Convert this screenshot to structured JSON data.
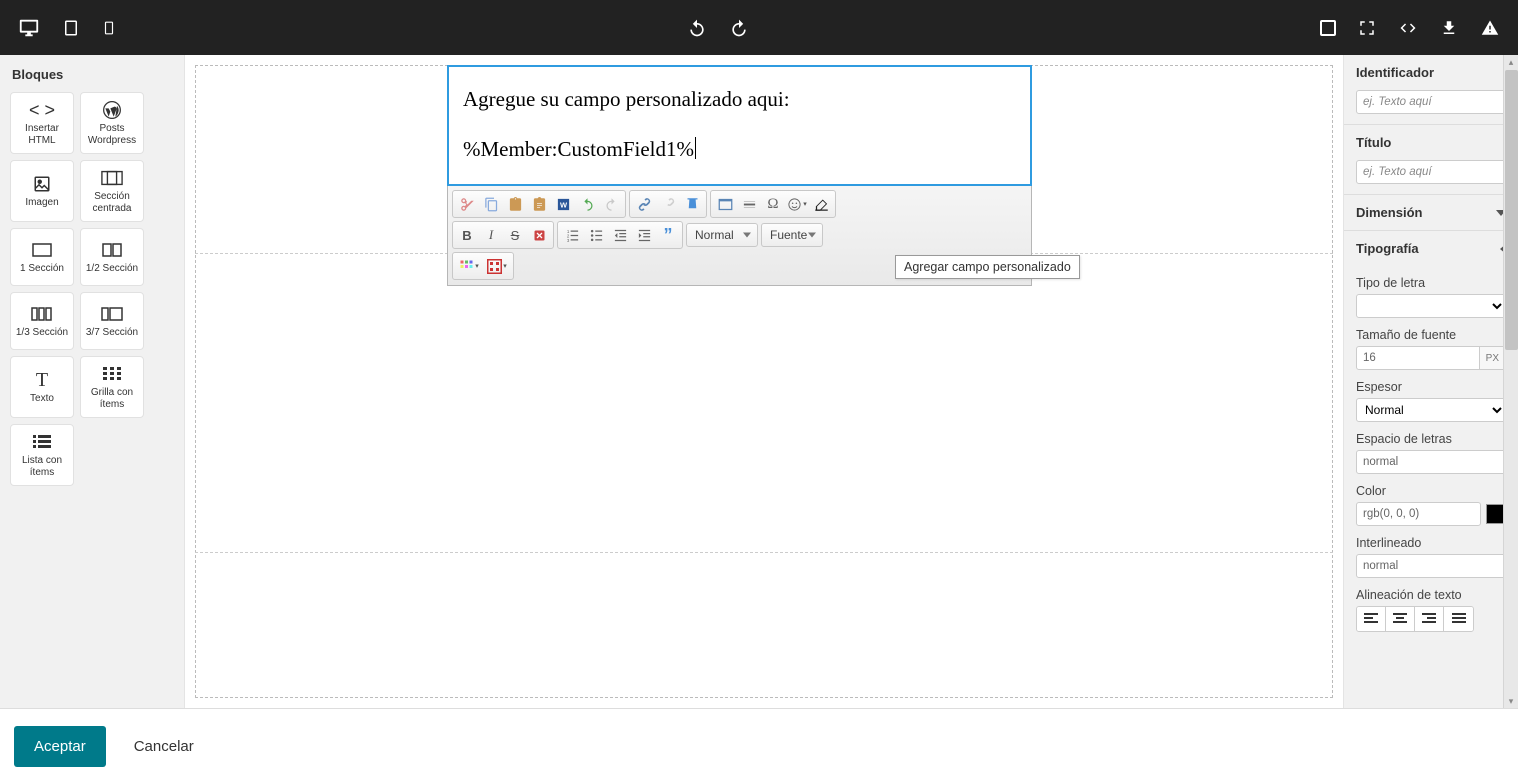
{
  "topbar": {
    "devices": [
      "desktop",
      "tablet",
      "mobile"
    ],
    "history": [
      "undo",
      "redo"
    ],
    "tools": [
      "outline",
      "fullscreen",
      "code",
      "download",
      "warning"
    ]
  },
  "leftPanel": {
    "title": "Bloques",
    "items": [
      {
        "label": "Insertar HTML",
        "icon": "code"
      },
      {
        "label": "Posts Wordpress",
        "icon": "wp"
      },
      {
        "label": "Imagen",
        "icon": "image"
      },
      {
        "label": "Sección centrada",
        "icon": "centered"
      },
      {
        "label": "1 Sección",
        "icon": "sec1"
      },
      {
        "label": "1/2 Sección",
        "icon": "sec2"
      },
      {
        "label": "1/3 Sección",
        "icon": "sec3"
      },
      {
        "label": "3/7 Sección",
        "icon": "sec37"
      },
      {
        "label": "Texto",
        "icon": "text"
      },
      {
        "label": "Grilla con ítems",
        "icon": "grid"
      },
      {
        "label": "Lista con ítems",
        "icon": "list"
      }
    ]
  },
  "editor": {
    "line1": "Agregue su campo personalizado aqui:",
    "line2": "%Member:CustomField1%",
    "tooltip": "Agregar campo personalizado",
    "formatSelect": "Normal",
    "fontSelect": "Fuente"
  },
  "rightPanel": {
    "sec_id": {
      "title": "Identificador",
      "placeholder": "ej. Texto aquí",
      "value": ""
    },
    "sec_title": {
      "title": "Título",
      "placeholder": "ej. Texto aquí",
      "value": ""
    },
    "sec_dim": {
      "title": "Dimensión"
    },
    "sec_typo": {
      "title": "Tipografía",
      "fontType": {
        "label": "Tipo de letra",
        "value": ""
      },
      "fontSize": {
        "label": "Tamaño de fuente",
        "value": "16",
        "unit": "PX"
      },
      "weight": {
        "label": "Espesor",
        "value": "Normal"
      },
      "letterSpacing": {
        "label": "Espacio de letras",
        "value": "normal"
      },
      "color": {
        "label": "Color",
        "value": "rgb(0, 0, 0)",
        "swatch": "#000000"
      },
      "lineHeight": {
        "label": "Interlineado",
        "value": "normal"
      },
      "align": {
        "label": "Alineación de texto"
      }
    }
  },
  "footer": {
    "accept": "Aceptar",
    "cancel": "Cancelar"
  }
}
